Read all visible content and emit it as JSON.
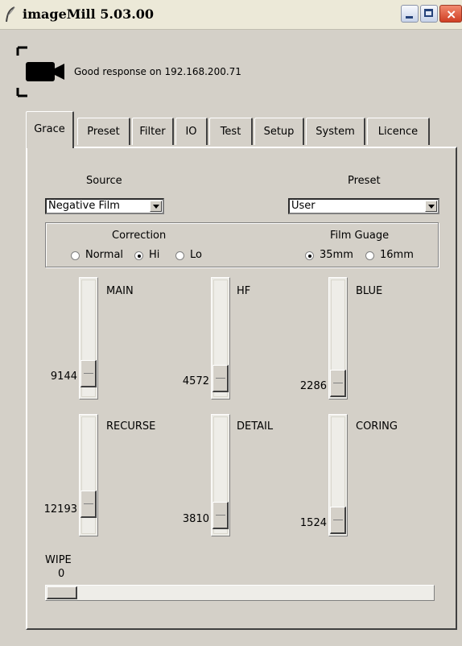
{
  "window": {
    "title": "imageMill 5.03.00"
  },
  "status": {
    "icon": "camera-icon",
    "message": "Good response on 192.168.200.71"
  },
  "tabs": [
    {
      "label": "Grace",
      "active": true
    },
    {
      "label": "Preset"
    },
    {
      "label": "Filter"
    },
    {
      "label": "IO"
    },
    {
      "label": "Test"
    },
    {
      "label": "Setup"
    },
    {
      "label": "System"
    },
    {
      "label": "Licence"
    }
  ],
  "source": {
    "label": "Source",
    "value": "Negative Film"
  },
  "preset": {
    "label": "Preset",
    "value": "User"
  },
  "correction": {
    "title": "Correction",
    "options": [
      "Normal",
      "Hi",
      "Lo"
    ],
    "selected": "Hi"
  },
  "film_guage": {
    "title": "Film Guage",
    "options": [
      "35mm",
      "16mm"
    ],
    "selected": "35mm"
  },
  "sliders": [
    {
      "label": "MAIN",
      "value": "9144"
    },
    {
      "label": "HF",
      "value": "4572"
    },
    {
      "label": "BLUE",
      "value": "2286"
    },
    {
      "label": "RECURSE",
      "value": "12193"
    },
    {
      "label": "DETAIL",
      "value": "3810"
    },
    {
      "label": "CORING",
      "value": "1524"
    }
  ],
  "wipe": {
    "label": "WIPE",
    "value": "0"
  }
}
